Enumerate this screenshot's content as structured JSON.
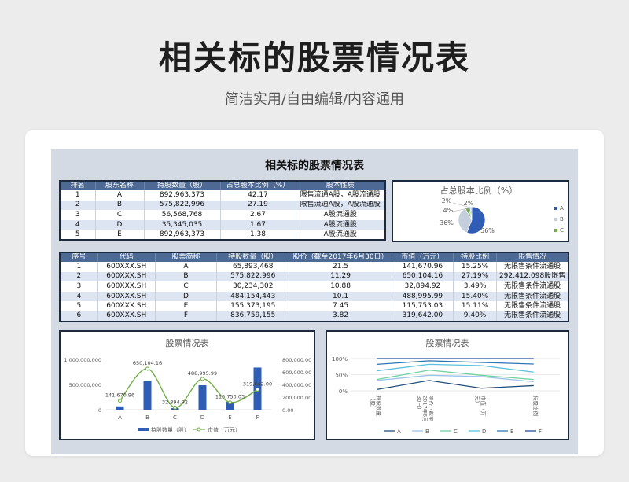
{
  "hero": {
    "title": "相关标的股票情况表",
    "subtitle": "简洁实用/自由编辑/内容通用"
  },
  "sheet_title": "相关标的股票情况表",
  "table1": {
    "headers": [
      "排名",
      "股东名称",
      "持股数量（股）",
      "占总股本比例（%）",
      "股本性质"
    ],
    "rows": [
      [
        "1",
        "A",
        "892,963,373",
        "42.17",
        "限售流通A股，A股流通股"
      ],
      [
        "2",
        "B",
        "575,822,996",
        "27.19",
        "限售流通A股，A股流通股"
      ],
      [
        "3",
        "C",
        "56,568,768",
        "2.67",
        "A股流通股"
      ],
      [
        "4",
        "D",
        "35,345,035",
        "1.67",
        "A股流通股"
      ],
      [
        "5",
        "E",
        "892,963,373",
        "1.38",
        "A股流通股"
      ]
    ]
  },
  "table2": {
    "headers": [
      "序号",
      "代码",
      "股票简称",
      "持股数量（股）",
      "股价（截至2017年6月30日）",
      "市值（万元）",
      "持股比例",
      "限售情况"
    ],
    "rows": [
      [
        "1",
        "600XXX.SH",
        "A",
        "65,893,468",
        "21.5",
        "141,670.96",
        "15.25%",
        "无限售条件流通股"
      ],
      [
        "2",
        "600XXX.SH",
        "B",
        "575,822,996",
        "11.29",
        "650,104.16",
        "27.19%",
        "292,412,098股限售"
      ],
      [
        "3",
        "600XXX.SH",
        "C",
        "30,234,302",
        "10.88",
        "32,894.92",
        "3.49%",
        "无限售条件流通股"
      ],
      [
        "4",
        "600XXX.SH",
        "D",
        "484,154,443",
        "10.1",
        "488,995.99",
        "15.40%",
        "无限售条件流通股"
      ],
      [
        "5",
        "600XXX.SH",
        "E",
        "155,373,195",
        "7.45",
        "115,753.03",
        "15.11%",
        "无限售条件流通股"
      ],
      [
        "6",
        "600XXX.SH",
        "F",
        "836,759,155",
        "3.82",
        "319,642.00",
        "9.40%",
        "无限售条件流通股"
      ]
    ]
  },
  "chart_data": [
    {
      "type": "pie",
      "title": "占总股本比例（%）",
      "categories": [
        "A",
        "B",
        "C"
      ],
      "values": [
        56,
        36,
        4,
        2,
        2
      ],
      "data_labels": [
        "56%",
        "36%",
        "4%",
        "2%",
        "2%"
      ],
      "legend": {
        "position": "right",
        "entries": [
          "A",
          "B",
          "C"
        ]
      },
      "colors": [
        "#2f5db5",
        "#c4cedd",
        "#70ad47",
        "#9e9e9e",
        "#9ad0f5"
      ]
    },
    {
      "type": "bar",
      "title": "股票情况表",
      "categories": [
        "A",
        "B",
        "C",
        "D",
        "E",
        "F"
      ],
      "series": [
        {
          "name": "持股数量（股）",
          "type": "bar",
          "axis": "left",
          "values": [
            65893468,
            575822996,
            30234302,
            484154443,
            155373195,
            836759155
          ],
          "color": "#2f5db5"
        },
        {
          "name": "市值（万元）",
          "type": "line",
          "axis": "right",
          "values": [
            141670.96,
            650104.16,
            32894.92,
            488995.99,
            115753.03,
            319642.0
          ],
          "labels": [
            "141,670.96",
            "650,104.16",
            "32,894.92",
            "488,995.99",
            "115,753.03",
            "319,642.00"
          ],
          "color": "#70ad47"
        }
      ],
      "y_left": {
        "ticks": [
          "0",
          "500,000,000",
          "1,000,000,000"
        ],
        "range": [
          0,
          1000000000
        ]
      },
      "y_right": {
        "ticks": [
          "0.00",
          "200,000.00",
          "400,000.00",
          "600,000.00",
          "800,000.00"
        ],
        "range": [
          0,
          800000
        ]
      },
      "legend": "bottom"
    },
    {
      "type": "line",
      "title": "股票情况表",
      "categories": [
        "持股数量（股）",
        "股价（截至2017年6月30日）",
        "市值（万元）",
        "持股比例"
      ],
      "category_labels": [
        "持股数量\n（股）",
        "股价（截至\n2017年6月\n30日）",
        "市值（万\n元）",
        "持股比例"
      ],
      "stacked_percent": true,
      "y_ticks": [
        "0%",
        "50%",
        "100%"
      ],
      "series": [
        {
          "name": "A",
          "values": [
            0.04,
            0.32,
            0.08,
            0.16
          ],
          "color": "#1f4e79"
        },
        {
          "name": "B",
          "values": [
            0.32,
            0.48,
            0.44,
            0.28
          ],
          "color": "#9dc3e6"
        },
        {
          "name": "C",
          "values": [
            0.35,
            0.64,
            0.48,
            0.35
          ],
          "color": "#70d0a0"
        },
        {
          "name": "D",
          "values": [
            0.62,
            0.82,
            0.78,
            0.58
          ],
          "color": "#5bc0de"
        },
        {
          "name": "E",
          "values": [
            0.82,
            0.93,
            0.88,
            0.83
          ],
          "color": "#2e75b6"
        },
        {
          "name": "F",
          "values": [
            1.0,
            1.0,
            1.0,
            1.0
          ],
          "color": "#1f4e9b"
        }
      ],
      "legend": "bottom"
    }
  ]
}
